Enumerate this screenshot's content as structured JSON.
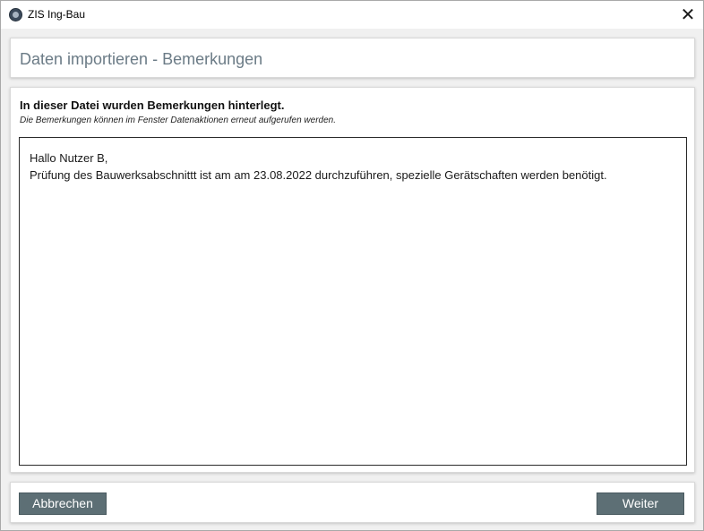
{
  "window": {
    "title": "ZIS Ing-Bau",
    "close_glyph": "✕"
  },
  "header": {
    "title": "Daten importieren - Bemerkungen"
  },
  "content": {
    "heading": "In dieser Datei wurden Bemerkungen hinterlegt.",
    "subheading": "Die Bemerkungen können im Fenster Datenaktionen erneut aufgerufen werden.",
    "remarks": {
      "line1": "Hallo Nutzer B,",
      "line2": "Prüfung des Bauwerksabschnittt ist am am 23.08.2022 durchzuführen, spezielle Gerätschaften werden benötigt."
    }
  },
  "footer": {
    "cancel_label": "Abbrechen",
    "next_label": "Weiter"
  },
  "colors": {
    "button_bg": "#5d6f75",
    "header_text": "#6b7b86",
    "window_bg": "#f0f0f0"
  },
  "icons": {
    "app": "app-logo-icon",
    "close": "close-icon"
  }
}
